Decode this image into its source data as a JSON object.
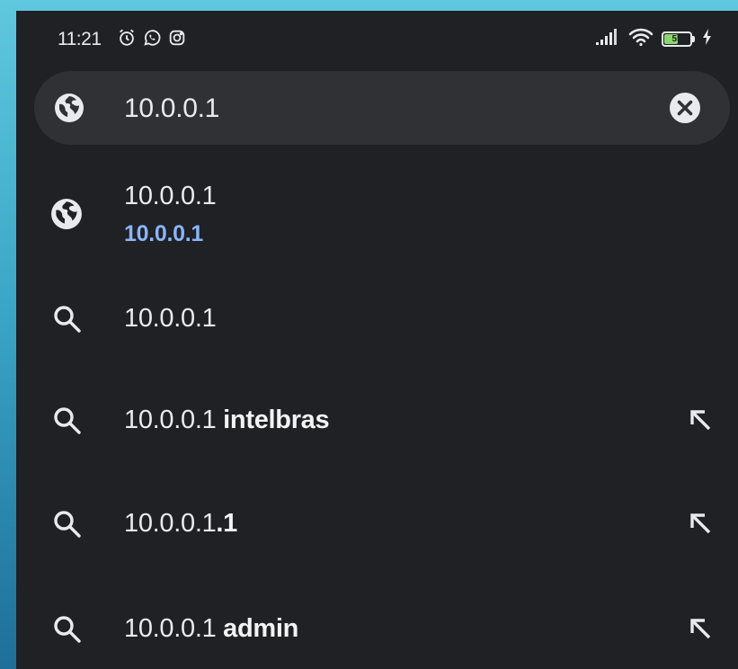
{
  "status_bar": {
    "time": "11:21",
    "notification_icons": [
      "alarm-icon",
      "whatsapp-icon",
      "instagram-icon"
    ],
    "battery_level": 55,
    "battery_text": "55",
    "battery_color": "#8bd56f"
  },
  "search": {
    "value": "10.0.0.1",
    "leading_icon": "globe-icon",
    "clear_icon": "close-circle-icon"
  },
  "suggestions": [
    {
      "type": "url",
      "icon": "globe-icon",
      "title": "10.0.0.1",
      "url": "10.0.0.1"
    },
    {
      "type": "search",
      "icon": "search-icon",
      "prefix": "10.0.0.1",
      "suffix": ""
    },
    {
      "type": "search",
      "icon": "search-icon",
      "prefix": "10.0.0.1 ",
      "suffix": "intelbras",
      "action": "fill-query-arrow-icon"
    },
    {
      "type": "search",
      "icon": "search-icon",
      "prefix": "10.0.0.1",
      "suffix": ".1",
      "action": "fill-query-arrow-icon"
    },
    {
      "type": "search",
      "icon": "search-icon",
      "prefix": "10.0.0.1 ",
      "suffix": "admin",
      "action": "fill-query-arrow-icon"
    }
  ],
  "colors": {
    "background": "#202124",
    "search_pill": "#303134",
    "text": "#e8eaed",
    "url_link": "#8ab4f8"
  }
}
